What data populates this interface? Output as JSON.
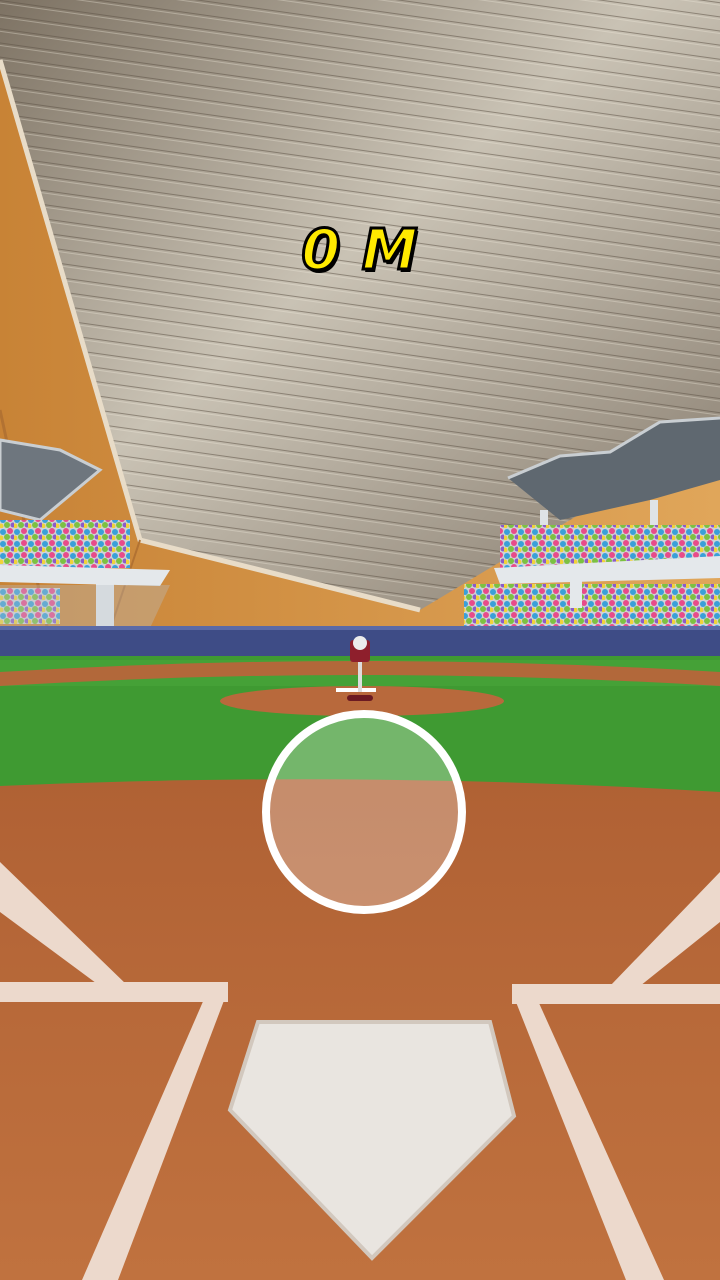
{
  "hud": {
    "distance_label": "0 M"
  },
  "aim": {
    "control": "aim-circle"
  },
  "colors": {
    "distance_text": "#ffea00",
    "dirt": "#b5663a",
    "grass": "#3f9a32",
    "wall": "#3e4c86",
    "roof": "#9e9384"
  }
}
